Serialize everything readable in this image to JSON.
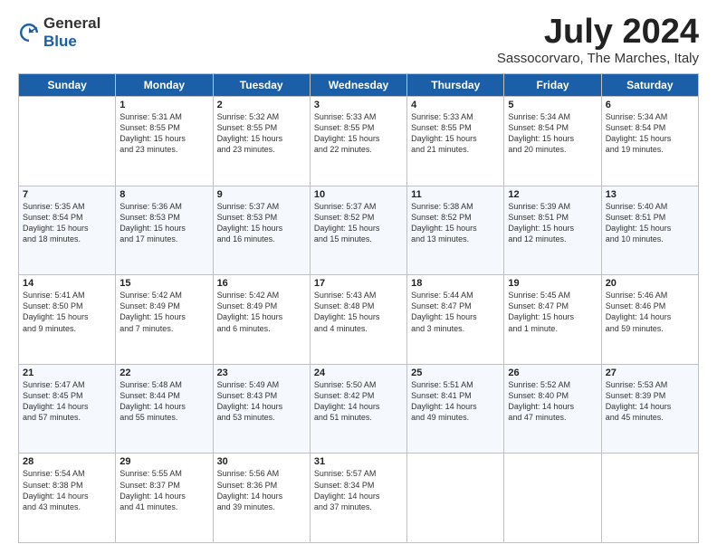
{
  "logo": {
    "general": "General",
    "blue": "Blue"
  },
  "header": {
    "title": "July 2024",
    "subtitle": "Sassocorvaro, The Marches, Italy"
  },
  "days": [
    "Sunday",
    "Monday",
    "Tuesday",
    "Wednesday",
    "Thursday",
    "Friday",
    "Saturday"
  ],
  "weeks": [
    [
      {
        "day": "",
        "content": ""
      },
      {
        "day": "1",
        "content": "Sunrise: 5:31 AM\nSunset: 8:55 PM\nDaylight: 15 hours\nand 23 minutes."
      },
      {
        "day": "2",
        "content": "Sunrise: 5:32 AM\nSunset: 8:55 PM\nDaylight: 15 hours\nand 23 minutes."
      },
      {
        "day": "3",
        "content": "Sunrise: 5:33 AM\nSunset: 8:55 PM\nDaylight: 15 hours\nand 22 minutes."
      },
      {
        "day": "4",
        "content": "Sunrise: 5:33 AM\nSunset: 8:55 PM\nDaylight: 15 hours\nand 21 minutes."
      },
      {
        "day": "5",
        "content": "Sunrise: 5:34 AM\nSunset: 8:54 PM\nDaylight: 15 hours\nand 20 minutes."
      },
      {
        "day": "6",
        "content": "Sunrise: 5:34 AM\nSunset: 8:54 PM\nDaylight: 15 hours\nand 19 minutes."
      }
    ],
    [
      {
        "day": "7",
        "content": "Sunrise: 5:35 AM\nSunset: 8:54 PM\nDaylight: 15 hours\nand 18 minutes."
      },
      {
        "day": "8",
        "content": "Sunrise: 5:36 AM\nSunset: 8:53 PM\nDaylight: 15 hours\nand 17 minutes."
      },
      {
        "day": "9",
        "content": "Sunrise: 5:37 AM\nSunset: 8:53 PM\nDaylight: 15 hours\nand 16 minutes."
      },
      {
        "day": "10",
        "content": "Sunrise: 5:37 AM\nSunset: 8:52 PM\nDaylight: 15 hours\nand 15 minutes."
      },
      {
        "day": "11",
        "content": "Sunrise: 5:38 AM\nSunset: 8:52 PM\nDaylight: 15 hours\nand 13 minutes."
      },
      {
        "day": "12",
        "content": "Sunrise: 5:39 AM\nSunset: 8:51 PM\nDaylight: 15 hours\nand 12 minutes."
      },
      {
        "day": "13",
        "content": "Sunrise: 5:40 AM\nSunset: 8:51 PM\nDaylight: 15 hours\nand 10 minutes."
      }
    ],
    [
      {
        "day": "14",
        "content": "Sunrise: 5:41 AM\nSunset: 8:50 PM\nDaylight: 15 hours\nand 9 minutes."
      },
      {
        "day": "15",
        "content": "Sunrise: 5:42 AM\nSunset: 8:49 PM\nDaylight: 15 hours\nand 7 minutes."
      },
      {
        "day": "16",
        "content": "Sunrise: 5:42 AM\nSunset: 8:49 PM\nDaylight: 15 hours\nand 6 minutes."
      },
      {
        "day": "17",
        "content": "Sunrise: 5:43 AM\nSunset: 8:48 PM\nDaylight: 15 hours\nand 4 minutes."
      },
      {
        "day": "18",
        "content": "Sunrise: 5:44 AM\nSunset: 8:47 PM\nDaylight: 15 hours\nand 3 minutes."
      },
      {
        "day": "19",
        "content": "Sunrise: 5:45 AM\nSunset: 8:47 PM\nDaylight: 15 hours\nand 1 minute."
      },
      {
        "day": "20",
        "content": "Sunrise: 5:46 AM\nSunset: 8:46 PM\nDaylight: 14 hours\nand 59 minutes."
      }
    ],
    [
      {
        "day": "21",
        "content": "Sunrise: 5:47 AM\nSunset: 8:45 PM\nDaylight: 14 hours\nand 57 minutes."
      },
      {
        "day": "22",
        "content": "Sunrise: 5:48 AM\nSunset: 8:44 PM\nDaylight: 14 hours\nand 55 minutes."
      },
      {
        "day": "23",
        "content": "Sunrise: 5:49 AM\nSunset: 8:43 PM\nDaylight: 14 hours\nand 53 minutes."
      },
      {
        "day": "24",
        "content": "Sunrise: 5:50 AM\nSunset: 8:42 PM\nDaylight: 14 hours\nand 51 minutes."
      },
      {
        "day": "25",
        "content": "Sunrise: 5:51 AM\nSunset: 8:41 PM\nDaylight: 14 hours\nand 49 minutes."
      },
      {
        "day": "26",
        "content": "Sunrise: 5:52 AM\nSunset: 8:40 PM\nDaylight: 14 hours\nand 47 minutes."
      },
      {
        "day": "27",
        "content": "Sunrise: 5:53 AM\nSunset: 8:39 PM\nDaylight: 14 hours\nand 45 minutes."
      }
    ],
    [
      {
        "day": "28",
        "content": "Sunrise: 5:54 AM\nSunset: 8:38 PM\nDaylight: 14 hours\nand 43 minutes."
      },
      {
        "day": "29",
        "content": "Sunrise: 5:55 AM\nSunset: 8:37 PM\nDaylight: 14 hours\nand 41 minutes."
      },
      {
        "day": "30",
        "content": "Sunrise: 5:56 AM\nSunset: 8:36 PM\nDaylight: 14 hours\nand 39 minutes."
      },
      {
        "day": "31",
        "content": "Sunrise: 5:57 AM\nSunset: 8:34 PM\nDaylight: 14 hours\nand 37 minutes."
      },
      {
        "day": "",
        "content": ""
      },
      {
        "day": "",
        "content": ""
      },
      {
        "day": "",
        "content": ""
      }
    ]
  ]
}
